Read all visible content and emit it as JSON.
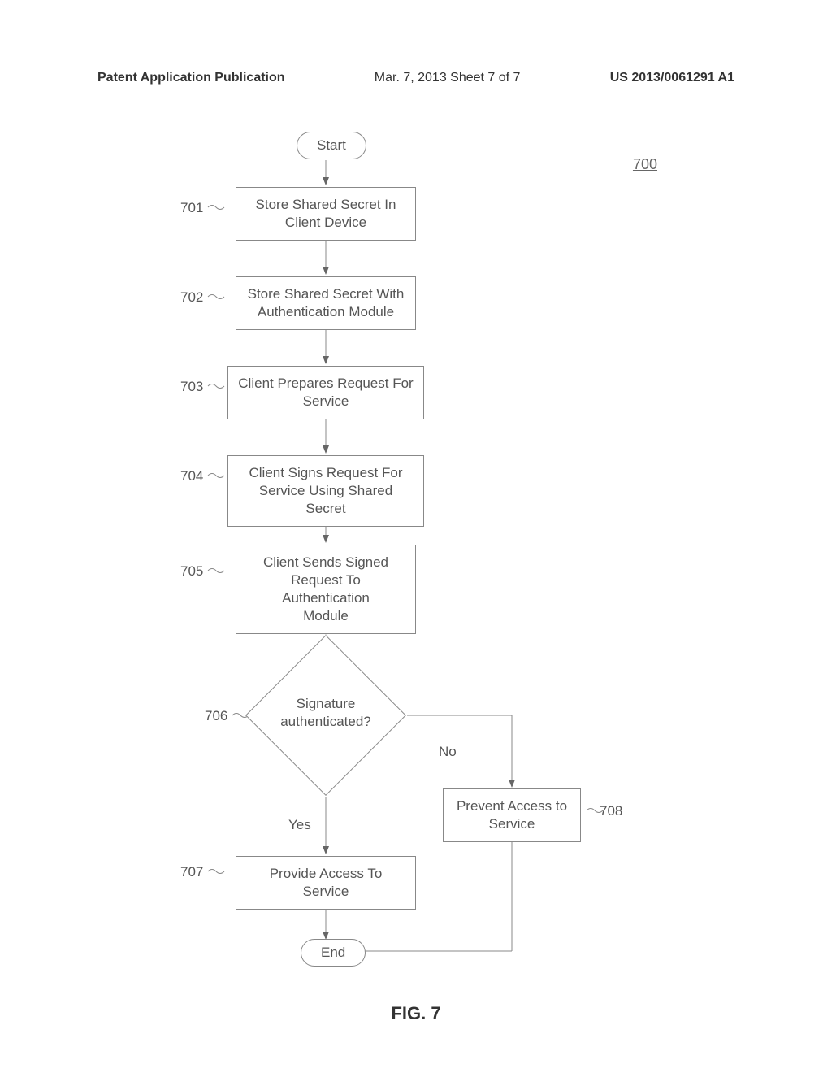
{
  "header": {
    "left": "Patent Application Publication",
    "center": "Mar. 7, 2013  Sheet 7 of 7",
    "right": "US 2013/0061291 A1"
  },
  "figure_ref": "700",
  "figure_title": "FIG. 7",
  "nodes": {
    "start": "Start",
    "n701": "Store Shared Secret In\nClient Device",
    "n702": "Store Shared Secret With\nAuthentication Module",
    "n703": "Client Prepares Request For\nService",
    "n704": "Client Signs Request For\nService Using Shared Secret",
    "n705": "Client Sends Signed\nRequest To Authentication\nModule",
    "n706": "Signature\nauthenticated?",
    "n707": "Provide Access To Service",
    "n708": "Prevent Access to\nService",
    "end": "End"
  },
  "labels": {
    "l701": "701",
    "l702": "702",
    "l703": "703",
    "l704": "704",
    "l705": "705",
    "l706": "706",
    "l707": "707",
    "l708": "708"
  },
  "edges": {
    "yes": "Yes",
    "no": "No"
  },
  "chart_data": {
    "type": "flowchart",
    "title": "FIG. 7",
    "figure_number": "700",
    "nodes": [
      {
        "id": "start",
        "type": "terminal",
        "label": "Start"
      },
      {
        "id": "701",
        "type": "process",
        "label": "Store Shared Secret In Client Device"
      },
      {
        "id": "702",
        "type": "process",
        "label": "Store Shared Secret With Authentication Module"
      },
      {
        "id": "703",
        "type": "process",
        "label": "Client Prepares Request For Service"
      },
      {
        "id": "704",
        "type": "process",
        "label": "Client Signs Request For Service Using Shared Secret"
      },
      {
        "id": "705",
        "type": "process",
        "label": "Client Sends Signed Request To Authentication Module"
      },
      {
        "id": "706",
        "type": "decision",
        "label": "Signature authenticated?"
      },
      {
        "id": "707",
        "type": "process",
        "label": "Provide Access To Service"
      },
      {
        "id": "708",
        "type": "process",
        "label": "Prevent Access to Service"
      },
      {
        "id": "end",
        "type": "terminal",
        "label": "End"
      }
    ],
    "edges": [
      {
        "from": "start",
        "to": "701"
      },
      {
        "from": "701",
        "to": "702"
      },
      {
        "from": "702",
        "to": "703"
      },
      {
        "from": "703",
        "to": "704"
      },
      {
        "from": "704",
        "to": "705"
      },
      {
        "from": "705",
        "to": "706"
      },
      {
        "from": "706",
        "to": "707",
        "label": "Yes"
      },
      {
        "from": "706",
        "to": "708",
        "label": "No"
      },
      {
        "from": "707",
        "to": "end"
      },
      {
        "from": "708",
        "to": "end"
      }
    ]
  }
}
